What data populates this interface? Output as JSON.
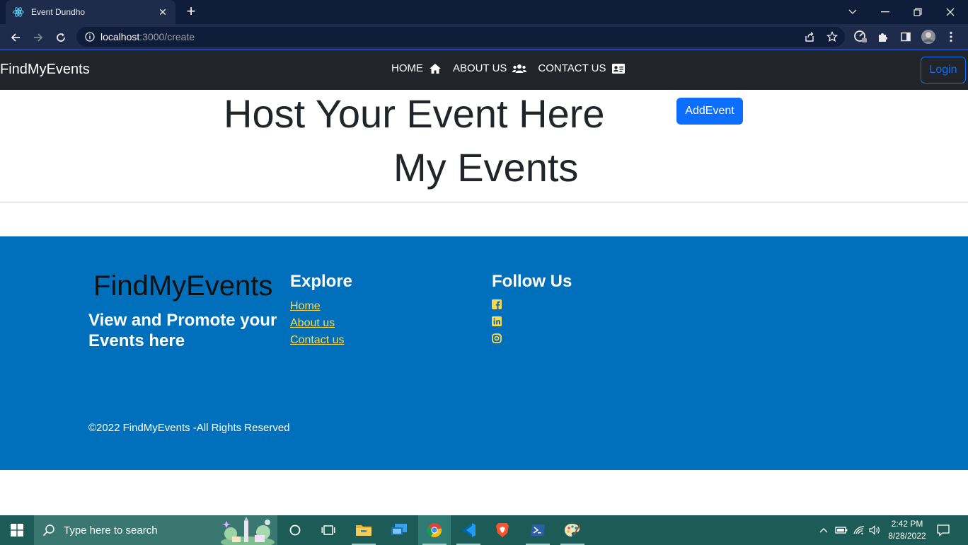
{
  "browser": {
    "tab_title": "Event Dundho",
    "tab_close": "✕",
    "new_tab": "+",
    "url_host": "localhost",
    "url_path": ":3000/create"
  },
  "navbar": {
    "brand": "FindMyEvents",
    "links": [
      {
        "label": "HOME",
        "icon": "home-icon"
      },
      {
        "label": "ABOUT US",
        "icon": "users-icon"
      },
      {
        "label": "CONTACT US",
        "icon": "id-card-icon"
      }
    ],
    "login_label": "Login"
  },
  "main": {
    "host_title": "Host Your Event Here",
    "add_event_label": "AddEvent",
    "my_events_title": "My Events"
  },
  "footer": {
    "brand": "FindMyEvents",
    "tagline": "View and Promote your Events here",
    "explore_heading": "Explore",
    "explore_links": [
      "Home",
      "About us",
      "Contact us"
    ],
    "follow_heading": "Follow Us",
    "social_icons": [
      "facebook-icon",
      "linkedin-icon",
      "instagram-icon"
    ],
    "copyright": "©2022 FindMyEvents -All Rights Reserved",
    "colors": {
      "background": "#0070bd",
      "link": "#ffd94a"
    }
  },
  "taskbar": {
    "search_placeholder": "Type here to search",
    "time": "2:42 PM",
    "date": "8/28/2022"
  }
}
